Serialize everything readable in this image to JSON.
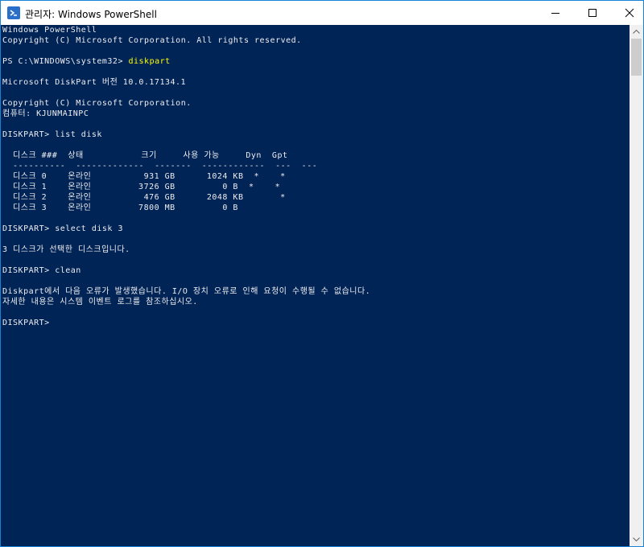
{
  "window": {
    "title": "관리자: Windows PowerShell"
  },
  "console": {
    "lines": [
      {
        "text": "Windows PowerShell"
      },
      {
        "text": "Copyright (C) Microsoft Corporation. All rights reserved."
      },
      {
        "text": ""
      },
      {
        "prompt": "PS C:\\WINDOWS\\system32> ",
        "command": "diskpart"
      },
      {
        "text": ""
      },
      {
        "text": "Microsoft DiskPart 버전 10.0.17134.1"
      },
      {
        "text": ""
      },
      {
        "text": "Copyright (C) Microsoft Corporation."
      },
      {
        "text": "컴퓨터: KJUNMAINPC"
      },
      {
        "text": ""
      },
      {
        "text": "DISKPART> list disk"
      },
      {
        "text": ""
      },
      {
        "text": "  디스크 ###  상태           크기     사용 가능     Dyn  Gpt"
      },
      {
        "text": "  ----------  -------------  -------  ------------  ---  ---"
      },
      {
        "text": "  디스크 0    온라인          931 GB      1024 KB  *    *"
      },
      {
        "text": "  디스크 1    온라인         3726 GB         0 B  *    *"
      },
      {
        "text": "  디스크 2    온라인          476 GB      2048 KB       *"
      },
      {
        "text": "  디스크 3    온라인         7800 MB         0 B"
      },
      {
        "text": ""
      },
      {
        "text": "DISKPART> select disk 3"
      },
      {
        "text": ""
      },
      {
        "text": "3 디스크가 선택한 디스크입니다."
      },
      {
        "text": ""
      },
      {
        "text": "DISKPART> clean"
      },
      {
        "text": ""
      },
      {
        "text": "Diskpart에서 다음 오류가 발생했습니다. I/O 장치 오류로 인해 요청이 수행될 수 없습니다."
      },
      {
        "text": "자세한 내용은 시스템 이벤트 로그를 참조하십시오."
      },
      {
        "text": ""
      },
      {
        "text": "DISKPART>"
      }
    ]
  },
  "colors": {
    "background": "#012456",
    "foreground": "#eeedf0",
    "command": "#ffff00",
    "window_border": "#1883d7"
  },
  "icons": {
    "app": "powershell-icon",
    "minimize": "minimize-icon",
    "maximize": "maximize-icon",
    "close": "close-icon",
    "scroll_up": "chevron-up-icon",
    "scroll_down": "chevron-down-icon"
  }
}
